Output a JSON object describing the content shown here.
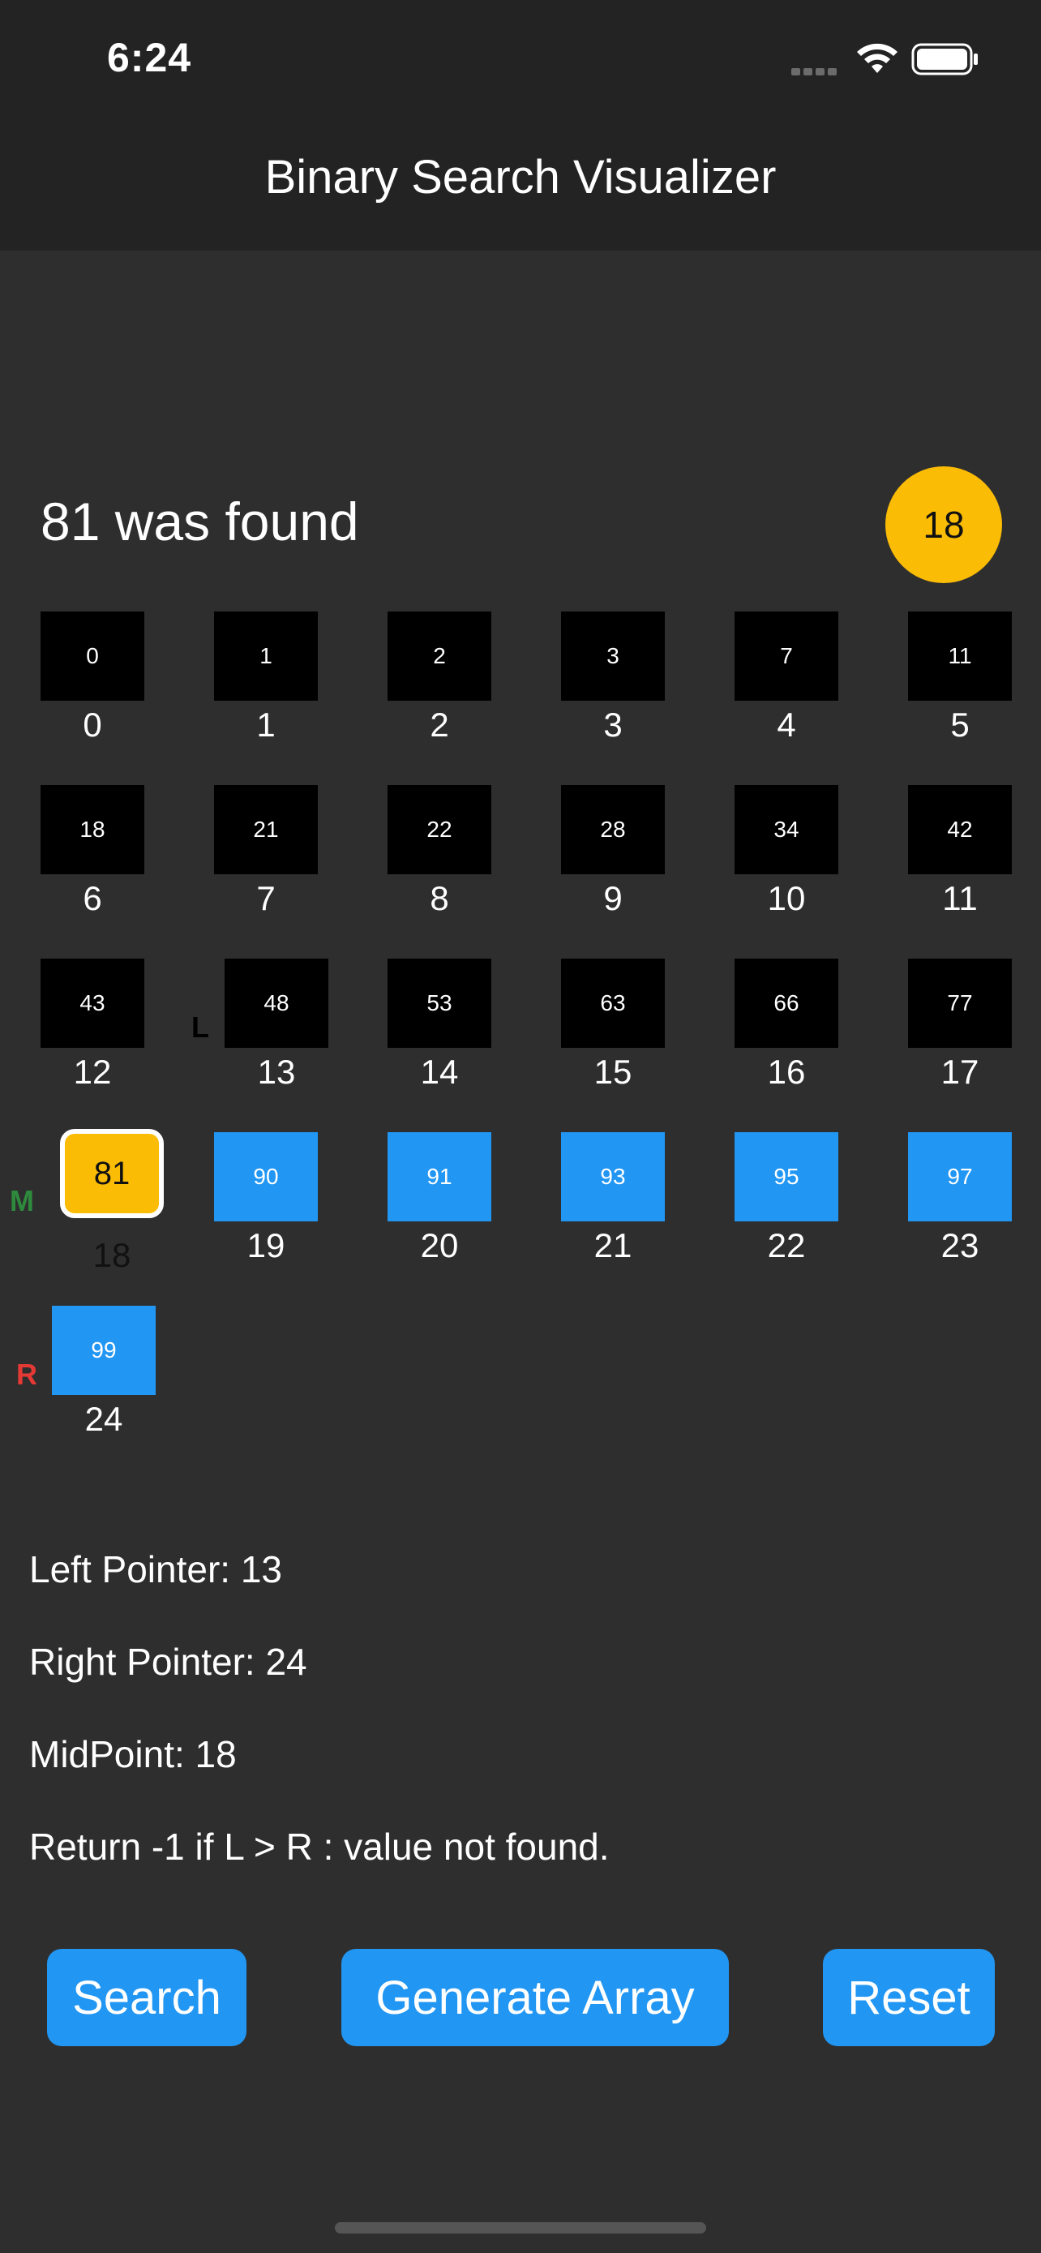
{
  "status_bar": {
    "time": "6:24"
  },
  "nav": {
    "title": "Binary Search Visualizer"
  },
  "result": {
    "message": "81 was found",
    "found_index": "18"
  },
  "array": [
    {
      "value": "0",
      "index": "0",
      "state": "black"
    },
    {
      "value": "1",
      "index": "1",
      "state": "black"
    },
    {
      "value": "2",
      "index": "2",
      "state": "black"
    },
    {
      "value": "3",
      "index": "3",
      "state": "black"
    },
    {
      "value": "7",
      "index": "4",
      "state": "black"
    },
    {
      "value": "11",
      "index": "5",
      "state": "black"
    },
    {
      "value": "18",
      "index": "6",
      "state": "black"
    },
    {
      "value": "21",
      "index": "7",
      "state": "black"
    },
    {
      "value": "22",
      "index": "8",
      "state": "black"
    },
    {
      "value": "28",
      "index": "9",
      "state": "black"
    },
    {
      "value": "34",
      "index": "10",
      "state": "black"
    },
    {
      "value": "42",
      "index": "11",
      "state": "black"
    },
    {
      "value": "43",
      "index": "12",
      "state": "black"
    },
    {
      "value": "48",
      "index": "13",
      "state": "black"
    },
    {
      "value": "53",
      "index": "14",
      "state": "black"
    },
    {
      "value": "63",
      "index": "15",
      "state": "black"
    },
    {
      "value": "66",
      "index": "16",
      "state": "black"
    },
    {
      "value": "77",
      "index": "17",
      "state": "black"
    },
    {
      "value": "81",
      "index": "18",
      "state": "found"
    },
    {
      "value": "90",
      "index": "19",
      "state": "blue"
    },
    {
      "value": "91",
      "index": "20",
      "state": "blue"
    },
    {
      "value": "93",
      "index": "21",
      "state": "blue"
    },
    {
      "value": "95",
      "index": "22",
      "state": "blue"
    },
    {
      "value": "97",
      "index": "23",
      "state": "blue"
    },
    {
      "value": "99",
      "index": "24",
      "state": "blue"
    }
  ],
  "pointers": {
    "left_label": "L",
    "mid_label": "M",
    "right_label": "R"
  },
  "info": {
    "left": "Left Pointer: 13",
    "right": "Right Pointer: 24",
    "mid": "MidPoint: 18",
    "note": "Return -1 if L > R : value not found."
  },
  "buttons": {
    "search": "Search",
    "generate": "Generate Array",
    "reset": "Reset"
  },
  "colors": {
    "found": "#fbbc05",
    "active": "#2196f3",
    "inactive": "#000000",
    "mid_pointer": "#2e8b3d",
    "right_pointer": "#e53935"
  }
}
